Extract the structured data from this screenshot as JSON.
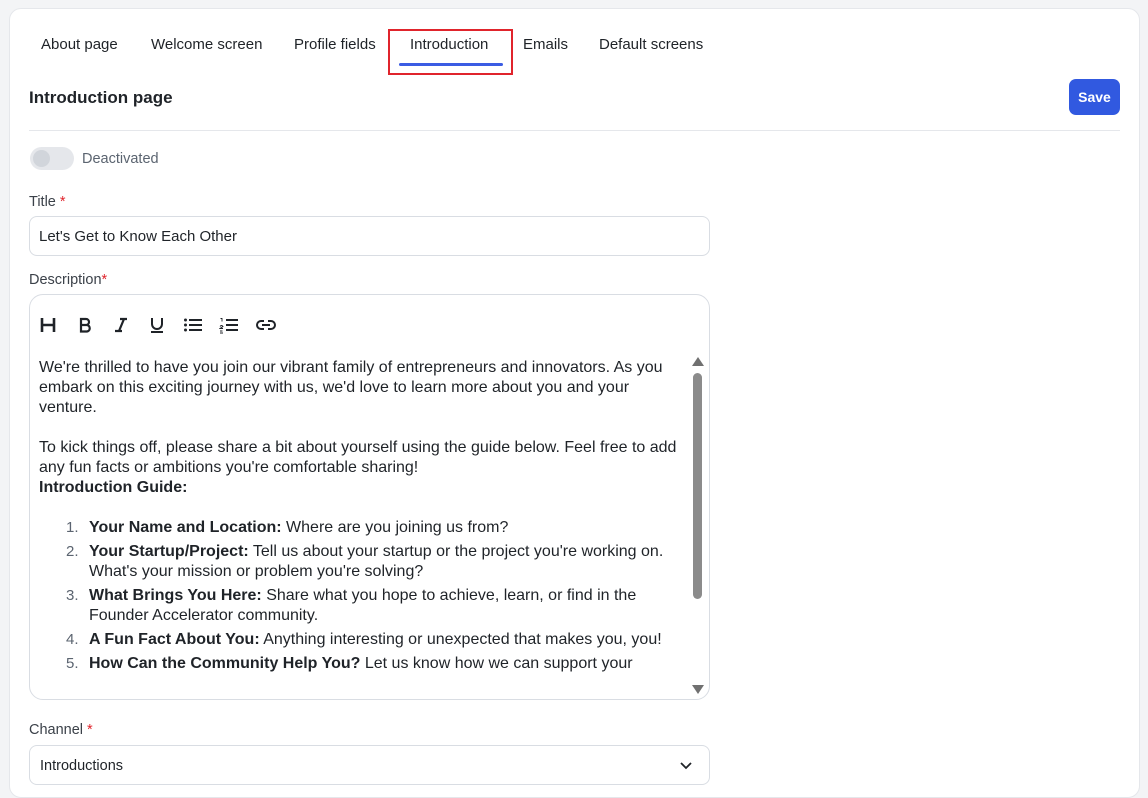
{
  "tabs": [
    {
      "label": "About page"
    },
    {
      "label": "Welcome screen"
    },
    {
      "label": "Profile fields"
    },
    {
      "label": "Introduction",
      "active": true
    },
    {
      "label": "Emails"
    },
    {
      "label": "Default screens"
    }
  ],
  "page": {
    "title": "Introduction page",
    "save_label": "Save",
    "toggle_label": "Deactivated",
    "toggle_on": false
  },
  "form": {
    "title_label": "Title",
    "required_mark": "*",
    "title_value": "Let's Get to Know Each Other",
    "description_label": "Description",
    "channel_label": "Channel",
    "channel_value": "Introductions"
  },
  "toolbar": [
    "heading-icon",
    "bold-icon",
    "italic-icon",
    "underline-icon",
    "bullet-list-icon",
    "numbered-list-icon",
    "link-icon"
  ],
  "description": {
    "p1": "We're thrilled to have you join our vibrant family of entrepreneurs and innovators. As you embark on this exciting journey with us, we'd love to learn more about you and your venture.",
    "p2": "To kick things off, please share a bit about yourself using the guide below. Feel free to add any fun facts or ambitions you're comfortable sharing!",
    "guide_heading": "Introduction Guide:",
    "items": [
      {
        "num": "1.",
        "bold": "Your Name and Location:",
        "text": " Where are you joining us from?"
      },
      {
        "num": "2.",
        "bold": "Your Startup/Project:",
        "text": " Tell us about your startup or the project you're working on. What's your mission or problem you're solving?"
      },
      {
        "num": "3.",
        "bold": "What Brings You Here:",
        "text": " Share what you hope to achieve, learn, or find in the Founder Accelerator community."
      },
      {
        "num": "4.",
        "bold": "A Fun Fact About You:",
        "text": " Anything interesting or unexpected that makes you, you!"
      },
      {
        "num": "5.",
        "bold": "How Can the Community Help You?",
        "text": " Let us know how we can support your"
      }
    ]
  },
  "colors": {
    "accent": "#3159e0",
    "tab_underline": "#3b5ce3",
    "highlight_box": "#e0242c",
    "required": "#e0242c"
  }
}
